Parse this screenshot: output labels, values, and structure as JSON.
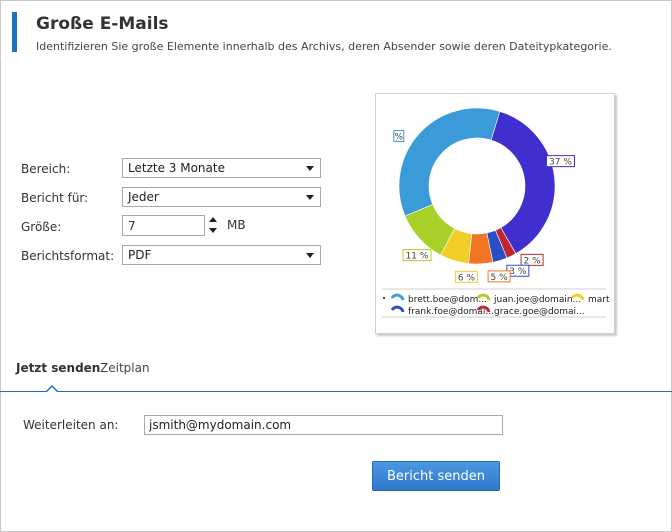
{
  "header": {
    "title": "Große E-Mails",
    "subtitle": "Identifizieren Sie große Elemente innerhalb des Archivs, deren Absender sowie deren Dateitypkategorie."
  },
  "form": {
    "range_label": "Bereich:",
    "range_value": "Letzte 3 Monate",
    "report_for_label": "Bericht für:",
    "report_for_value": "Jeder",
    "size_label": "Größe:",
    "size_value": "7",
    "size_unit": "MB",
    "format_label": "Berichtsformat:",
    "format_value": "PDF"
  },
  "chart_data": {
    "type": "pie",
    "donut": true,
    "slices": [
      {
        "label": "brett.boe@dom...",
        "value": 37,
        "color": "#3f2fcf",
        "pct_label": "37 %"
      },
      {
        "label": "grace.goe@domai...",
        "value": 2,
        "color": "#c0262c",
        "pct_label": "2 %"
      },
      {
        "label": "frank.foe@domai...",
        "value": 3,
        "color": "#2a4fc4",
        "pct_label": "3 %"
      },
      {
        "label": "",
        "value": 5,
        "color": "#f07623",
        "pct_label": "5 %"
      },
      {
        "label": "mart",
        "value": 6,
        "color": "#f2cf28",
        "pct_label": "6 %"
      },
      {
        "label": "juan.joe@domain...",
        "value": 11,
        "color": "#a7d129",
        "pct_label": "11 %"
      },
      {
        "label": "",
        "value": 36,
        "color": "#3a9bd8",
        "pct_label": "%"
      }
    ],
    "legend": [
      {
        "label": "brett.boe@dom...",
        "color": "#3a9bd8"
      },
      {
        "label": "juan.joe@domain...",
        "color": "#a7d129"
      },
      {
        "label": "mart",
        "color": "#f2cf28"
      },
      {
        "label": "frank.foe@domai...",
        "color": "#2a4fc4"
      },
      {
        "label": "grace.goe@domai...",
        "color": "#c0262c"
      }
    ]
  },
  "tabs": [
    {
      "label": "Jetzt senden",
      "active": true
    },
    {
      "label": "Zeitplan",
      "active": false
    }
  ],
  "send": {
    "forward_label": "Weiterleiten an:",
    "forward_value": "jsmith@mydomain.com",
    "button_label": "Bericht senden"
  },
  "colors": {
    "accent": "#1b72c0",
    "button": "#3a87d8"
  }
}
